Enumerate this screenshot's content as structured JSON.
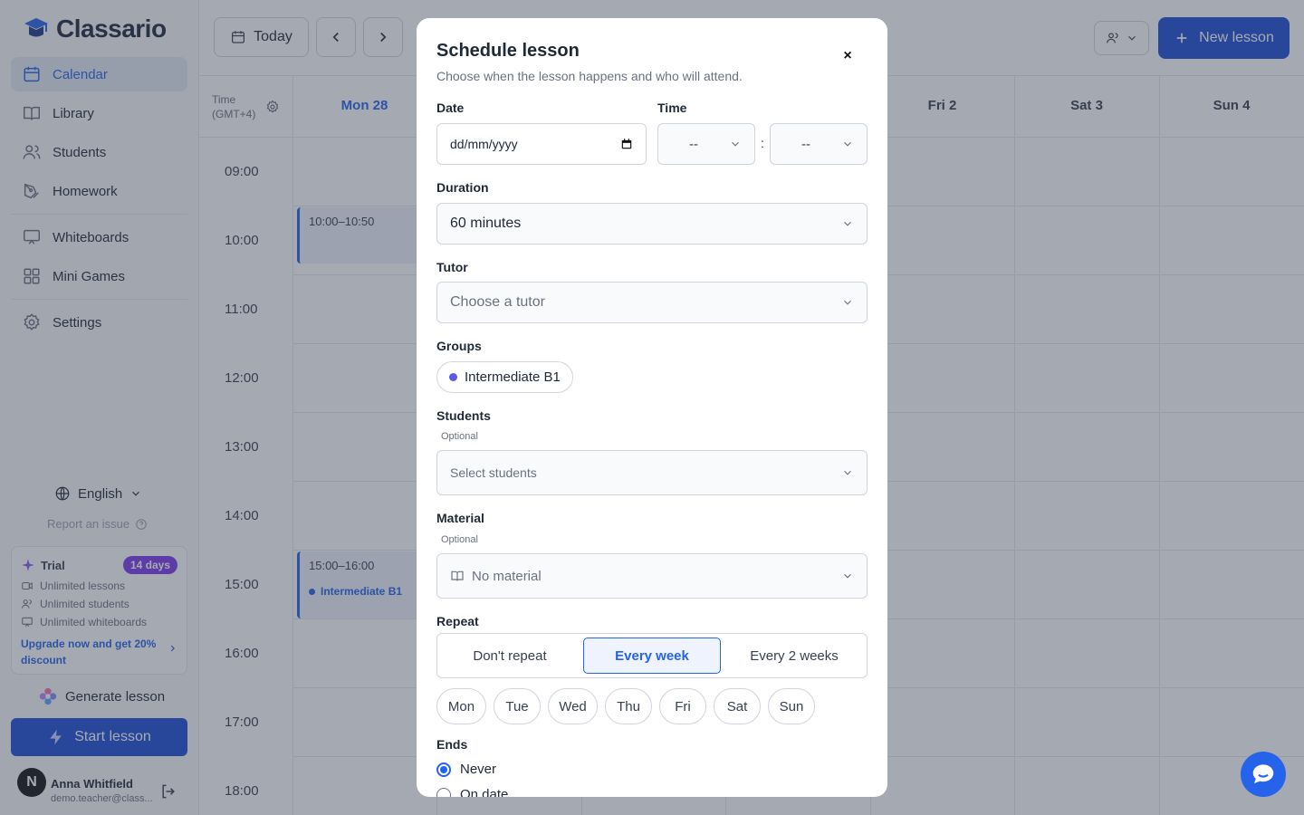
{
  "app": {
    "name": "Classario"
  },
  "sidebar": {
    "items": [
      {
        "label": "Calendar"
      },
      {
        "label": "Library"
      },
      {
        "label": "Students"
      },
      {
        "label": "Homework"
      },
      {
        "label": "Whiteboards"
      },
      {
        "label": "Mini Games"
      },
      {
        "label": "Settings"
      }
    ],
    "language": "English",
    "report_issue": "Report an issue",
    "trial": {
      "title": "Trial",
      "badge": "14 days",
      "features": [
        "Unlimited lessons",
        "Unlimited students",
        "Unlimited whiteboards"
      ],
      "upgrade": "Upgrade now and get 20% discount"
    },
    "generate_lesson": "Generate lesson",
    "start_lesson": "Start lesson",
    "user": {
      "initial": "N",
      "name": "Anna Whitfield",
      "email": "demo.teacher@class..."
    }
  },
  "toolbar": {
    "today": "Today",
    "new_lesson": "New lesson"
  },
  "calendar": {
    "time_label": "Time",
    "timezone": "(GMT+4)",
    "days": [
      "Mon 28",
      "Fri 2",
      "Sat 3",
      "Sun 4"
    ],
    "hours": [
      "09:00",
      "10:00",
      "11:00",
      "12:00",
      "13:00",
      "14:00",
      "15:00",
      "16:00",
      "17:00",
      "18:00"
    ],
    "events": [
      {
        "time": "10:00–10:50"
      },
      {
        "time": "15:00–16:00",
        "group": "Intermediate B1"
      }
    ]
  },
  "modal": {
    "title": "Schedule lesson",
    "subtitle": "Choose when the lesson happens and who will attend.",
    "close": "×",
    "date_label": "Date",
    "date_value": "dd/mm/yyyy",
    "time_label": "Time",
    "hour_value": "--",
    "minute_value": "--",
    "time_sep": ":",
    "duration_label": "Duration",
    "duration_value": "60 minutes",
    "tutor_label": "Tutor",
    "tutor_placeholder": "Choose a tutor",
    "groups_label": "Groups",
    "group_chip": "Intermediate B1",
    "students_label": "Students",
    "students_optional": "Optional",
    "students_placeholder": "Select students",
    "material_label": "Material",
    "material_optional": "Optional",
    "material_value": "No material",
    "repeat_label": "Repeat",
    "repeat_options": [
      "Don't repeat",
      "Every week",
      "Every 2 weeks"
    ],
    "repeat_selected": "Every week",
    "weekdays": [
      "Mon",
      "Tue",
      "Wed",
      "Thu",
      "Fri",
      "Sat",
      "Sun"
    ],
    "ends_label": "Ends",
    "ends_options": [
      "Never",
      "On date"
    ],
    "ends_selected": "Never"
  },
  "colors": {
    "accent": "#2563eb",
    "brand_dark": "#1d4ed8",
    "trial_badge": "#7c3aed",
    "group_dot": "#5b5be6"
  }
}
